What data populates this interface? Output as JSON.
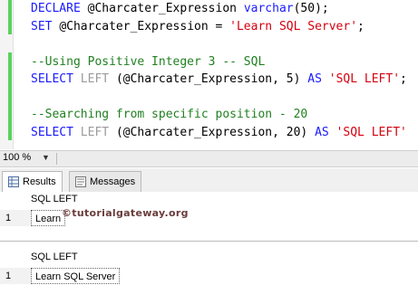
{
  "editor": {
    "lines": [
      [
        {
          "c": "kw",
          "t": "DECLARE "
        },
        {
          "c": "id",
          "t": "@Charcater_Expression "
        },
        {
          "c": "ty",
          "t": "varchar"
        },
        {
          "c": "tx",
          "t": "(50);"
        }
      ],
      [
        {
          "c": "kw",
          "t": "SET "
        },
        {
          "c": "id",
          "t": "@Charcater_Expression = "
        },
        {
          "c": "str",
          "t": "'Learn SQL Server'"
        },
        {
          "c": "tx",
          "t": ";"
        }
      ],
      [],
      [
        {
          "c": "cm",
          "t": "--Using Positive Integer 3 -- SQL"
        }
      ],
      [
        {
          "c": "kw",
          "t": "SELECT "
        },
        {
          "c": "fn",
          "t": "LEFT "
        },
        {
          "c": "tx",
          "t": "(@Charcater_Expression, 5) "
        },
        {
          "c": "kw",
          "t": "AS "
        },
        {
          "c": "str",
          "t": "'SQL LEFT'"
        },
        {
          "c": "tx",
          "t": ";"
        }
      ],
      [],
      [
        {
          "c": "cm",
          "t": "--Searching from specific position - 20"
        }
      ],
      [
        {
          "c": "kw",
          "t": "SELECT "
        },
        {
          "c": "fn",
          "t": "LEFT "
        },
        {
          "c": "tx",
          "t": "(@Charcater_Expression, 20) "
        },
        {
          "c": "kw",
          "t": "AS "
        },
        {
          "c": "str",
          "t": "'SQL LEFT'"
        }
      ]
    ]
  },
  "zoom": {
    "level": "100 %"
  },
  "tabs": [
    {
      "label": "Results",
      "icon": "grid-icon"
    },
    {
      "label": "Messages",
      "icon": "message-icon"
    }
  ],
  "results": {
    "grid1": {
      "column": "SQL LEFT",
      "rows": [
        {
          "num": "1",
          "value": "Learn"
        }
      ]
    },
    "grid2": {
      "column": "SQL LEFT",
      "rows": [
        {
          "num": "1",
          "value": "Learn SQL Server"
        }
      ]
    }
  },
  "watermark": "©tutorialgateway.org",
  "colors": {
    "keyword": "#1a1aff",
    "string": "#d4000f",
    "comment": "#208020",
    "function": "#9b9b9b"
  }
}
